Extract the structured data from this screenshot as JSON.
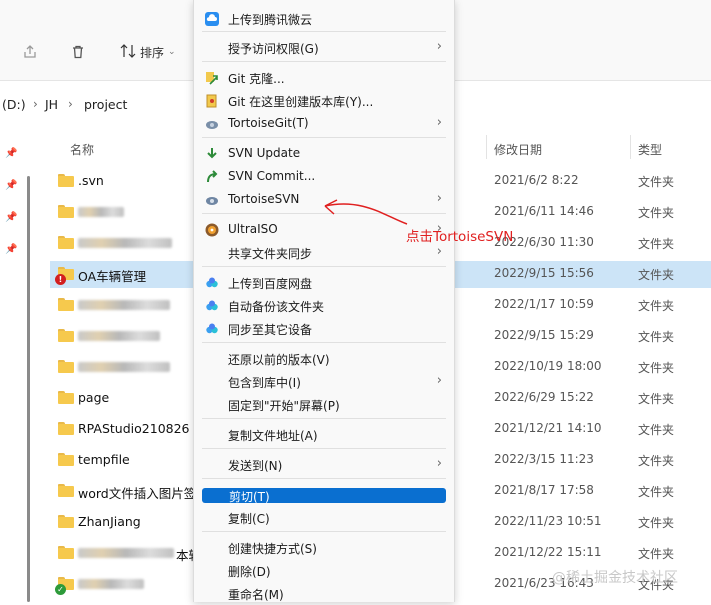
{
  "toolbar": {
    "sort_label": "排序",
    "share_icon": "share-icon",
    "delete_icon": "trash-icon",
    "sort_icon": "sort-icon"
  },
  "breadcrumb": [
    "(D:)",
    "JH",
    "project"
  ],
  "columns": {
    "name": "名称",
    "date": "修改日期",
    "type": "类型"
  },
  "files": [
    {
      "name": ".svn",
      "date": "2021/6/2 8:22",
      "type": "文件夹",
      "blurred": false
    },
    {
      "name": "",
      "date": "2021/6/11 14:46",
      "type": "文件夹",
      "blurred": true
    },
    {
      "name": "",
      "date": "2022/6/30 11:30",
      "type": "文件夹",
      "blurred": true
    },
    {
      "name": "OA车辆管理",
      "date": "2022/9/15 15:56",
      "type": "文件夹",
      "blurred": false,
      "selected": true,
      "badge": "warning"
    },
    {
      "name": "",
      "date": "2022/1/17 10:59",
      "type": "文件夹",
      "blurred": true
    },
    {
      "name": "",
      "date": "2022/9/15 15:29",
      "type": "文件夹",
      "blurred": true
    },
    {
      "name": "",
      "date": "2022/10/19 18:00",
      "type": "文件夹",
      "blurred": true
    },
    {
      "name": "page",
      "date": "2022/6/29 15:22",
      "type": "文件夹",
      "blurred": false
    },
    {
      "name": "RPAStudio210826",
      "date": "2021/12/21 14:10",
      "type": "文件夹",
      "blurred": false
    },
    {
      "name": "tempfile",
      "date": "2022/3/15 11:23",
      "type": "文件夹",
      "blurred": false
    },
    {
      "name": "word文件插入图片签",
      "date": "2021/8/17 17:58",
      "type": "文件夹",
      "blurred": false
    },
    {
      "name": "ZhanJiang",
      "date": "2022/11/23 10:51",
      "type": "文件夹",
      "blurred": false
    },
    {
      "name": "本轴",
      "date": "2021/12/22 15:11",
      "type": "文件夹",
      "blurred": true
    },
    {
      "name": "",
      "date": "2021/6/23 16:43",
      "type": "文件夹",
      "blurred": true,
      "badge": "ok"
    }
  ],
  "menu": [
    {
      "label": "上传到腾讯微云",
      "icon": "tencent-weiyun-icon"
    },
    {
      "label": "授予访问权限(G)",
      "icon": "",
      "arrow": "›"
    },
    {
      "label": "Git 克隆...",
      "icon": "git-clone-icon"
    },
    {
      "label": "Git 在这里创建版本库(Y)...",
      "icon": "git-create-repo-icon"
    },
    {
      "label": "TortoiseGit(T)",
      "icon": "tortoisegit-icon",
      "arrow": "›"
    },
    {
      "label": "SVN Update",
      "icon": "svn-update-icon"
    },
    {
      "label": "SVN Commit...",
      "icon": "svn-commit-icon"
    },
    {
      "label": "TortoiseSVN",
      "icon": "tortoisesvn-icon",
      "arrow": "›"
    },
    {
      "label": "UltraISO",
      "icon": "ultraiso-icon",
      "arrow": "›"
    },
    {
      "label": "共享文件夹同步",
      "icon": "",
      "arrow": "›"
    },
    {
      "label": "上传到百度网盘",
      "icon": "baidu-netdisk-icon"
    },
    {
      "label": "自动备份该文件夹",
      "icon": "baidu-netdisk-icon"
    },
    {
      "label": "同步至其它设备",
      "icon": "baidu-netdisk-icon"
    },
    {
      "label": "还原以前的版本(V)",
      "icon": ""
    },
    {
      "label": "包含到库中(I)",
      "icon": "",
      "arrow": "›"
    },
    {
      "label": "固定到\"开始\"屏幕(P)",
      "icon": ""
    },
    {
      "label": "复制文件地址(A)",
      "icon": ""
    },
    {
      "label": "发送到(N)",
      "icon": "",
      "arrow": "›"
    },
    {
      "label": "剪切(T)",
      "icon": ""
    },
    {
      "label": "复制(C)",
      "icon": ""
    },
    {
      "label": "创建快捷方式(S)",
      "icon": ""
    },
    {
      "label": "删除(D)",
      "icon": ""
    },
    {
      "label": "重命名(M)",
      "icon": ""
    }
  ],
  "annotation": "点击TortoiseSVN",
  "watermark": "@稀土掘金技术社区",
  "colors": {
    "selection": "#cce4f7",
    "highlight": "#0a6fd0",
    "annotation": "#e02020",
    "folder": "#f6c94d"
  }
}
